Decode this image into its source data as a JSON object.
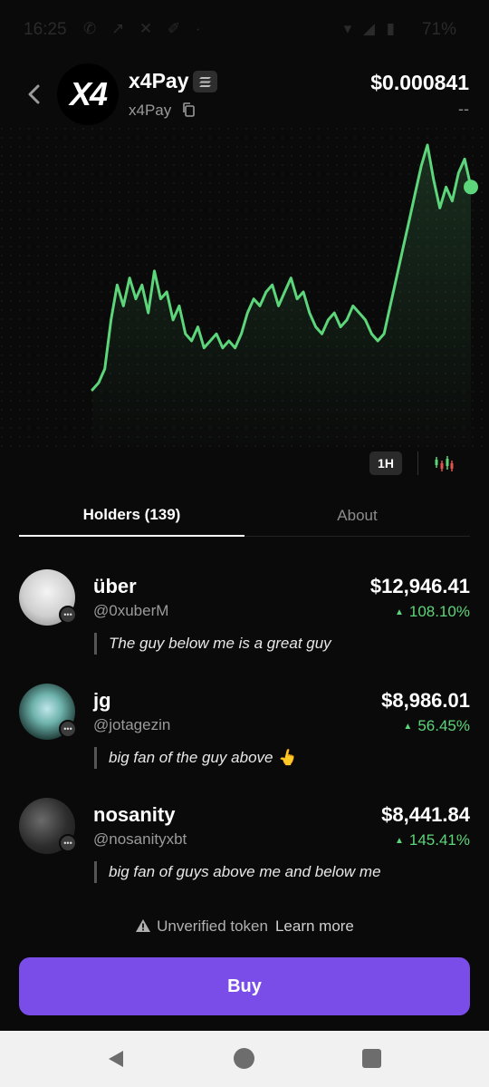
{
  "status_bar": {
    "time": "16:25",
    "notification_icons": "✆ ↗ ✕ ✐ ·",
    "battery": "71%",
    "system_icons": "▾ ◢ ▮"
  },
  "header": {
    "token_name": "x4Pay",
    "token_ticker": "x4Pay",
    "logo_text": "X4",
    "price": "$0.000841",
    "price_change": "--"
  },
  "chart_data": {
    "type": "line",
    "interval": "1H",
    "color": "#5dd57a",
    "values": [
      0,
      1,
      3,
      10,
      15,
      12,
      16,
      13,
      15,
      11,
      17,
      13,
      14,
      10,
      12,
      8,
      7,
      9,
      6,
      7,
      8,
      6,
      7,
      6,
      8,
      11,
      13,
      12,
      14,
      15,
      12,
      14,
      16,
      13,
      14,
      11,
      9,
      8,
      10,
      11,
      9,
      10,
      12,
      11,
      10,
      8,
      7,
      8,
      12,
      16,
      20,
      24,
      28,
      32,
      35,
      30,
      26,
      29,
      27,
      31,
      33,
      29
    ]
  },
  "controls": {
    "interval_label": "1H"
  },
  "tabs": {
    "holders": "Holders (139)",
    "about": "About"
  },
  "holders": [
    {
      "name": "über",
      "handle": "@0xuberM",
      "value": "$12,946.41",
      "change": "108.10%",
      "quote": "The guy below me is a great guy",
      "avatar_color": "#d8d8d8"
    },
    {
      "name": "jg",
      "handle": "@jotagezin",
      "value": "$8,986.01",
      "change": "56.45%",
      "quote": "big fan of the guy above 👆",
      "avatar_color": "#2a4a45"
    },
    {
      "name": "nosanity",
      "handle": "@nosanityxbt",
      "value": "$8,441.84",
      "change": "145.41%",
      "quote": "big fan of guys above me and below me",
      "avatar_color": "#3a3a3a"
    }
  ],
  "footer": {
    "unverified_text": "Unverified token",
    "learn_more": "Learn more",
    "buy_label": "Buy"
  },
  "colors": {
    "accent": "#7a4de8",
    "positive": "#5dd57a"
  }
}
